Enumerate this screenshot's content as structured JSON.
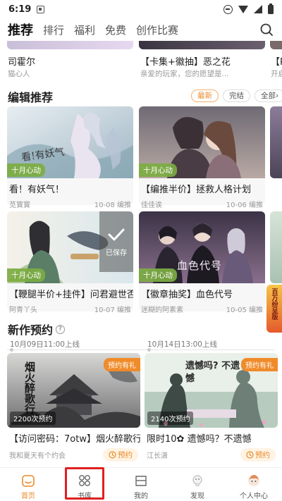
{
  "status_bar": {
    "time": "6:19"
  },
  "top_nav": {
    "tabs": [
      {
        "label": "推荐",
        "active": true
      },
      {
        "label": "排行",
        "active": false
      },
      {
        "label": "福利",
        "active": false
      },
      {
        "label": "免费",
        "active": false
      },
      {
        "label": "创作比赛",
        "active": false
      }
    ],
    "search_icon": "search-icon"
  },
  "top_partial": {
    "cards": [
      {
        "title": "司霍尔",
        "sub": "猫心人"
      },
      {
        "title": "【卡集+徽抽】恶之花",
        "sub": "亲爱的玩家，您的愿望是..."
      },
      {
        "title": "【P",
        "sub": "开启"
      }
    ]
  },
  "editor_picks": {
    "title": "编辑推荐",
    "filters": [
      {
        "label": "最新",
        "active": true
      },
      {
        "label": "完结",
        "active": false
      },
      {
        "label": "全部",
        "active": false,
        "chevron": "›"
      }
    ],
    "cards": [
      {
        "tag": "十月心动",
        "cover_text": "看!有妖气",
        "title": "看！有妖气！",
        "author": "苋寳寳",
        "date": "10-08 编推"
      },
      {
        "tag": "十月心动",
        "cover_text": "",
        "title": "【编推半价】拯救人格计划",
        "author": "佳佳诶",
        "date": "10-06 编推"
      },
      {
        "tag": "十月心动",
        "cover_text": "",
        "title": "【鞭腿半价+挂件】问君避世否",
        "author": "阿青丫头",
        "date": "10-07 编推",
        "saved_label": "已保存"
      },
      {
        "tag": "十月心动",
        "cover_text": "血色代号",
        "title": "【徽章抽奖】血色代号",
        "author": "迷糊的阿素素",
        "date": "10-05 编推"
      }
    ],
    "side_text": "百万纷呈版"
  },
  "new_reservations": {
    "title": "新作预约",
    "help_icon": "question-circle-icon",
    "dates": [
      "10月09日11:00上线",
      "10月14日13:00上线"
    ],
    "cards": [
      {
        "count": "2200次预约",
        "gift": "预约有礼",
        "cover_text": "烟火醉歌行",
        "title": "【访问密码：7otw】烟火醉歌行",
        "author": "我和夏天有个约会",
        "button": "预约"
      },
      {
        "count": "2140次预约",
        "gift": "预约有礼",
        "cover_text": "遗憾吗? 不遗憾",
        "title": "限时10✿ 遗憾吗？不遗憾",
        "author": "江长潇",
        "button": "预约"
      }
    ]
  },
  "bottom_nav": {
    "items": [
      {
        "label": "首页",
        "icon": "home-icon",
        "active": true
      },
      {
        "label": "书库",
        "icon": "library-grid-icon",
        "active": false
      },
      {
        "label": "我的",
        "icon": "bookshelf-icon",
        "active": false
      },
      {
        "label": "发现",
        "icon": "discover-icon",
        "active": false
      },
      {
        "label": "个人中心",
        "icon": "profile-avatar-icon",
        "active": false
      }
    ]
  },
  "colors": {
    "accent": "#e98a2a",
    "tag_green": "#7cad42",
    "highlight": "#e02020"
  }
}
